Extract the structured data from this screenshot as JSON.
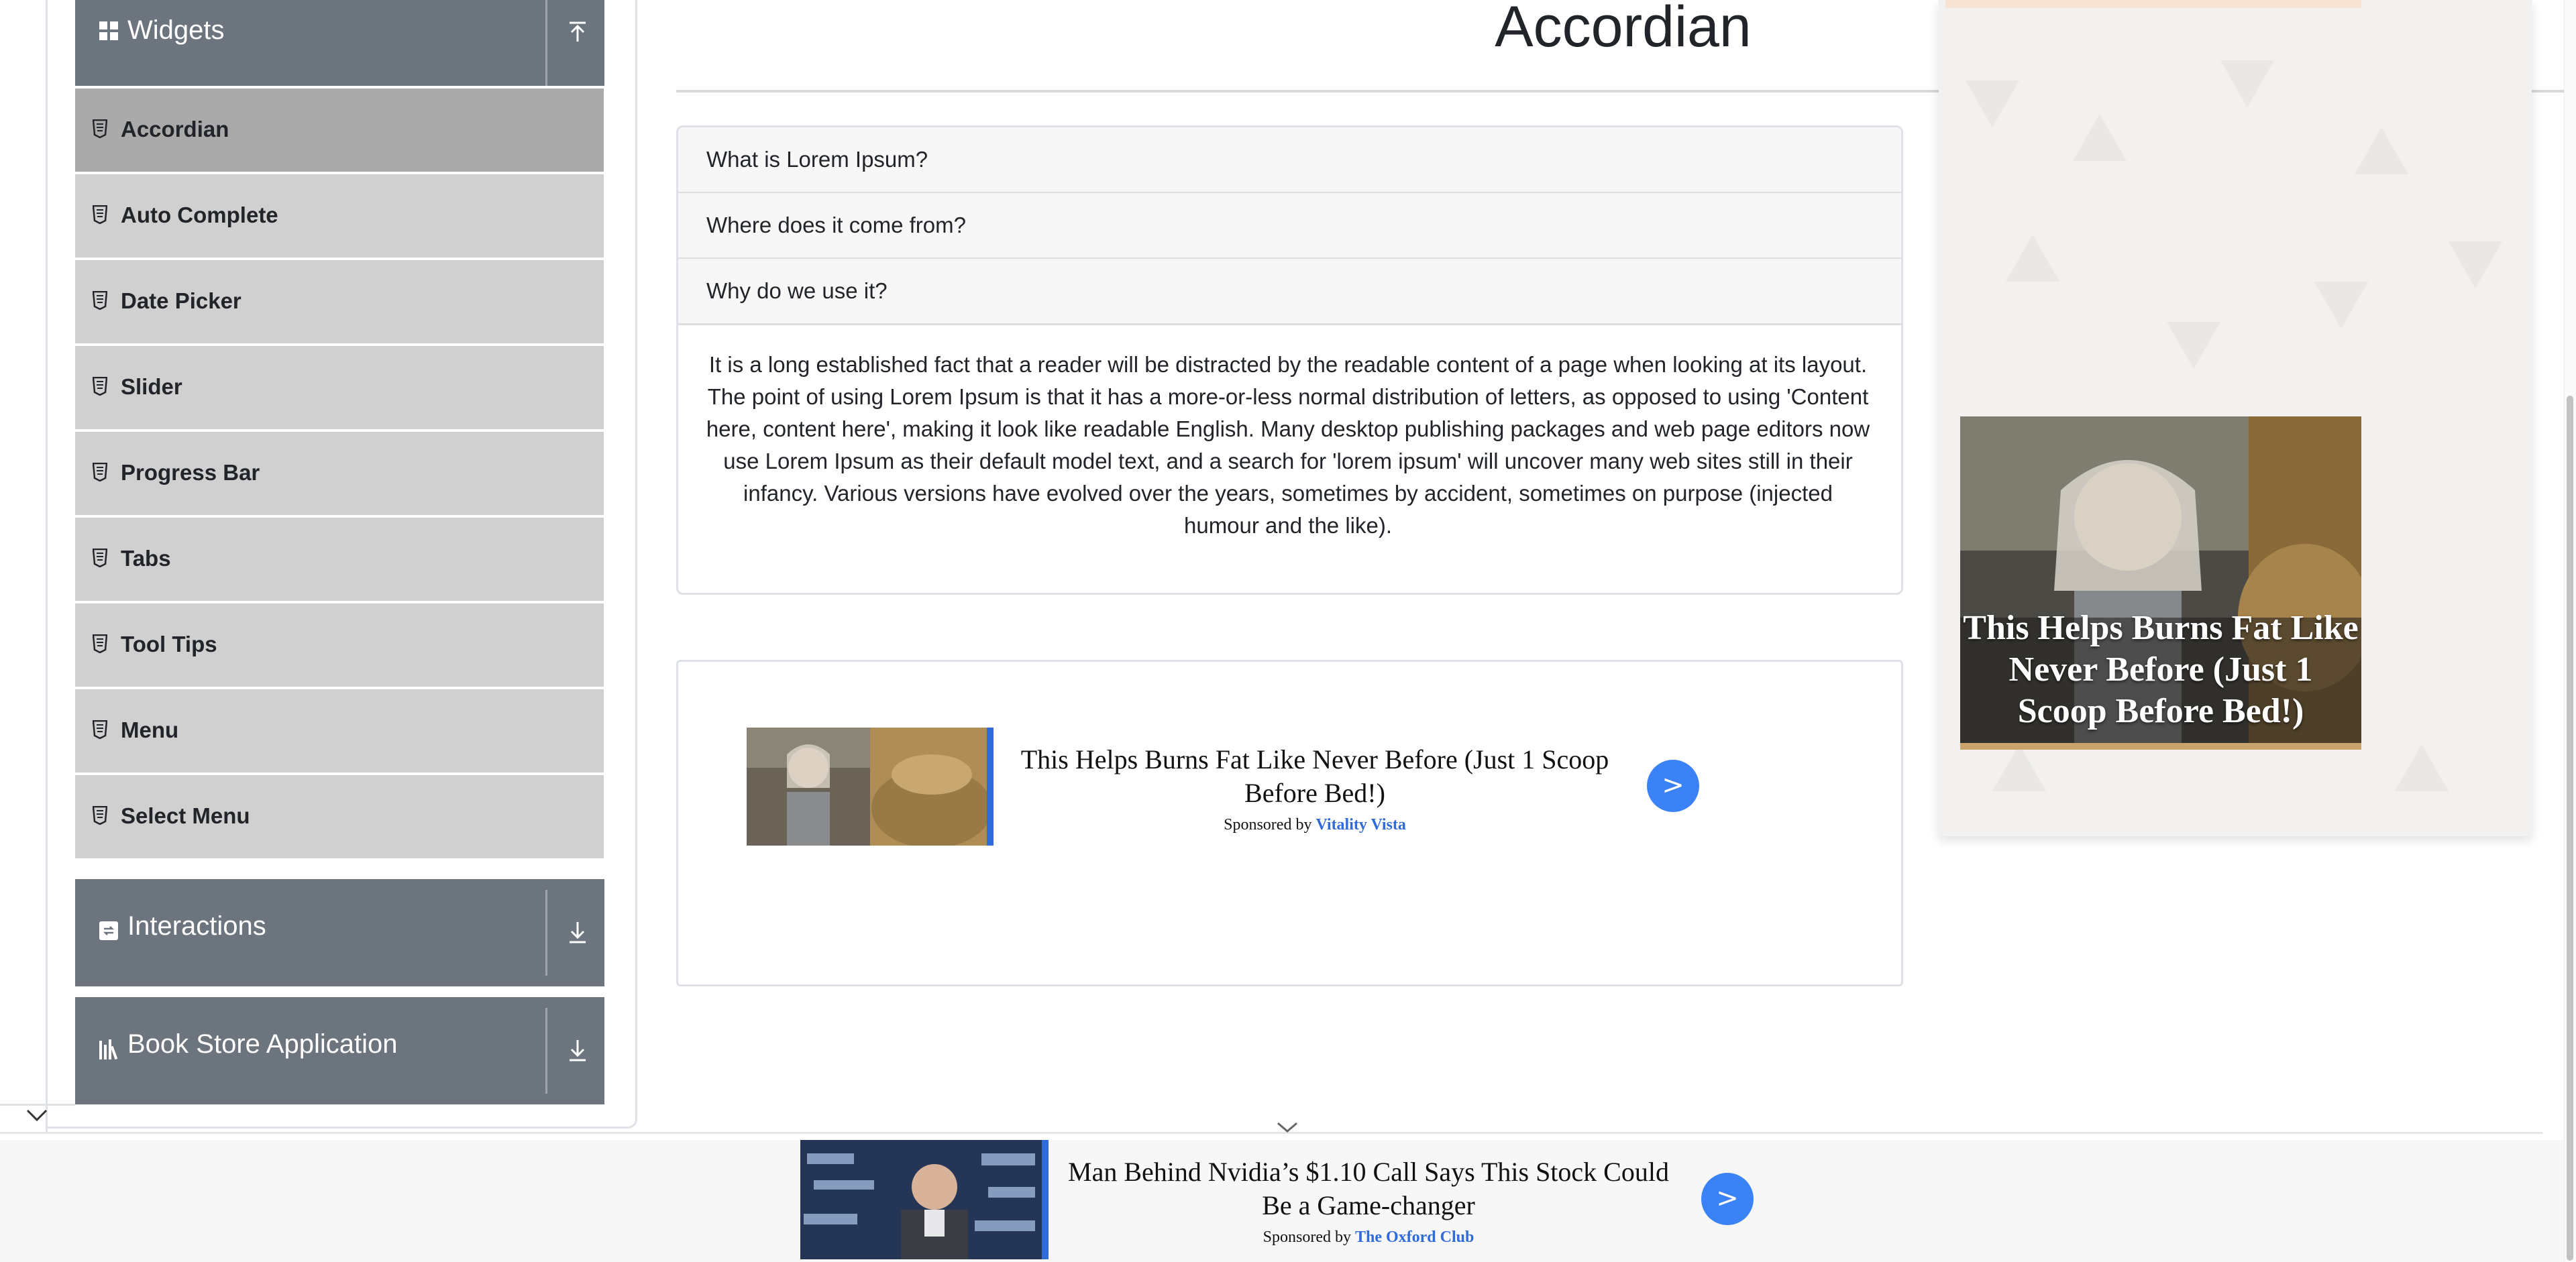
{
  "sidebar": {
    "widgets_group": {
      "label": "Widgets",
      "toggle": "collapse-up-icon"
    },
    "items": [
      {
        "label": "Accordian",
        "active": true
      },
      {
        "label": "Auto Complete",
        "active": false
      },
      {
        "label": "Date Picker",
        "active": false
      },
      {
        "label": "Slider",
        "active": false
      },
      {
        "label": "Progress Bar",
        "active": false
      },
      {
        "label": "Tabs",
        "active": false
      },
      {
        "label": "Tool Tips",
        "active": false
      },
      {
        "label": "Menu",
        "active": false
      },
      {
        "label": "Select Menu",
        "active": false
      }
    ],
    "interactions_group": {
      "label": "Interactions",
      "toggle": "expand-down-icon"
    },
    "bookstore_group": {
      "label": "Book Store Application",
      "toggle": "expand-down-icon"
    }
  },
  "main": {
    "title": "Accordian",
    "sections": [
      {
        "header": "What is Lorem Ipsum?",
        "expanded": false
      },
      {
        "header": "Where does it come from?",
        "expanded": false
      },
      {
        "header": "Why do we use it?",
        "expanded": true,
        "body": "It is a long established fact that a reader will be distracted by the readable content of a page when looking at its layout. The point of using Lorem Ipsum is that it has a more-or-less normal distribution of letters, as opposed to using 'Content here, content here', making it look like readable English. Many desktop publishing packages and web page editors now use Lorem Ipsum as their default model text, and a search for 'lorem ipsum' will uncover many web sites still in their infancy. Various versions have evolved over the years, sometimes by accident, sometimes on purpose (injected humour and the like)."
      }
    ]
  },
  "content_ad": {
    "title": "This Helps Burns Fat Like Never Before (Just 1 Scoop Before Bed!)",
    "sponsored_prefix": "Sponsored by",
    "sponsor": "Vitality Vista",
    "button": ">"
  },
  "side_ad": {
    "text": "This Helps Burns Fat Like Never Before (Just 1 Scoop Before Bed!)"
  },
  "sticky_ad": {
    "title": "Man Behind Nvidia’s $1.10 Call Says This Stock Could Be a Game-changer",
    "sponsored_prefix": "Sponsored by",
    "sponsor": "The Oxford Club",
    "button": ">"
  },
  "colors": {
    "group_header": "#6c757d",
    "menu_item": "#d0d0d0",
    "menu_item_active": "#aaaaaa",
    "ad_button": "#3b82f6",
    "sponsor_link": "#2f6bd9"
  }
}
